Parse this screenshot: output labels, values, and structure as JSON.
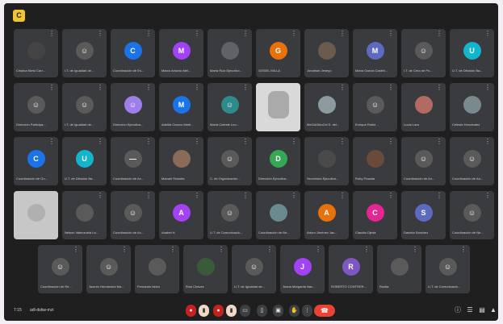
{
  "app": {
    "badge_initial": "C"
  },
  "bottom_bar": {
    "time": "7:15",
    "code": "adl-dsbw-mzi"
  },
  "rows": [
    [
      {
        "label": "Cristina Nieto Carr...",
        "initial": "",
        "color": "#444"
      },
      {
        "label": "I.T. de Igualdad de...",
        "initial": "☺",
        "color": "#5a5a5a"
      },
      {
        "label": "Coordinación de Es...",
        "initial": "C",
        "color": "#1a73e8"
      },
      {
        "label": "Marco Antonio Mel...",
        "initial": "M",
        "color": "#a142f4"
      },
      {
        "label": "Marta Ruiz Ejecutivo...",
        "initial": "",
        "color": "#5f6368"
      },
      {
        "label": "GISSEL MILLA",
        "initial": "G",
        "color": "#e8710a"
      },
      {
        "label": "Jonathan Jeneyo",
        "initial": "",
        "color": "#6b5a4e"
      },
      {
        "label": "María García Castell...",
        "initial": "M",
        "color": "#5c6bc0"
      },
      {
        "label": "I.T. de Cero de Po...",
        "initial": "☺",
        "color": "#5a5a5a"
      },
      {
        "label": "U.T. de Difusión Ba...",
        "initial": "U",
        "color": "#12b5cb"
      }
    ],
    [
      {
        "label": "Dirección Participa...",
        "initial": "☺",
        "color": "#5a5a5a"
      },
      {
        "label": "I.T. de Igualdad de...",
        "initial": "☺",
        "color": "#5a5a5a"
      },
      {
        "label": "Dirección Ejecutiva...",
        "initial": "☺",
        "color": "#9e7ee8"
      },
      {
        "label": "Adelita Orozco Marti...",
        "initial": "M",
        "color": "#1a73e8"
      },
      {
        "label": "María Celeste Leo...",
        "initial": "☺",
        "color": "#2f8a8a"
      },
      {
        "label": "",
        "initial": "",
        "color": "#aaa",
        "type": "video"
      },
      {
        "label": "MeGADibuCel S. del...",
        "initial": "",
        "color": "#8c9aa0"
      },
      {
        "label": "Enrique Roble...",
        "initial": "☺",
        "color": "#5a5a5a"
      },
      {
        "label": "Lucía Lara",
        "initial": "",
        "color": "#b46a64"
      },
      {
        "label": "Celeste Hernández",
        "initial": "",
        "color": "#7a8a8c"
      }
    ],
    [
      {
        "label": "Coordinación de Go...",
        "initial": "C",
        "color": "#1a73e8"
      },
      {
        "label": "U.T. de Difusión Ba...",
        "initial": "U",
        "color": "#12b5cb"
      },
      {
        "label": "Coordinación de Ac...",
        "initial": "—",
        "color": "#5a5a5a"
      },
      {
        "label": "Manuel Rosales",
        "initial": "",
        "color": "#8a6b5a"
      },
      {
        "label": "C. de Organización...",
        "initial": "☺",
        "color": "#5a5a5a"
      },
      {
        "label": "Dirección Ejecutiva...",
        "initial": "D",
        "color": "#34a853"
      },
      {
        "label": "Secretaría Ejecutiva...",
        "initial": "",
        "color": "#4a4a4a"
      },
      {
        "label": "Ruby Posada",
        "initial": "",
        "color": "#6a4a3a"
      },
      {
        "label": "Coordinación de An...",
        "initial": "☺",
        "color": "#5a5a5a"
      },
      {
        "label": "Coordinación de An...",
        "initial": "☺",
        "color": "#5a5a5a"
      }
    ],
    [
      {
        "label": "Alma Armendáriz",
        "initial": "",
        "color": "#b0b0b0",
        "type": "photo"
      },
      {
        "label": "Nelson Valenzuela La...",
        "initial": "",
        "color": "#5a5a5a"
      },
      {
        "label": "Coordinación de Ac...",
        "initial": "☺",
        "color": "#5a5a5a"
      },
      {
        "label": "Anabel H",
        "initial": "A",
        "color": "#a142f4"
      },
      {
        "label": "U.T. de Comunicació...",
        "initial": "☺",
        "color": "#5a5a5a"
      },
      {
        "label": "Coordinación de Be...",
        "initial": "",
        "color": "#6a8a90"
      },
      {
        "label": "Arturo Jiménez Jac...",
        "initial": "A",
        "color": "#e8710a"
      },
      {
        "label": "Claudia Ojeda",
        "initial": "C",
        "color": "#e52592"
      },
      {
        "label": "Daniela Sánchez",
        "initial": "S",
        "color": "#5c6bc0"
      },
      {
        "label": "Coordinación de Ne...",
        "initial": "☺",
        "color": "#5a5a5a"
      }
    ],
    [
      {
        "label": "Coordinación de Re...",
        "initial": "☺",
        "color": "#5a5a5a"
      },
      {
        "label": "Jazmín Hernández Ma...",
        "initial": "☺",
        "color": "#5a5a5a"
      },
      {
        "label": "Fernando Isidro",
        "initial": "",
        "color": "#5a5a5a"
      },
      {
        "label": "Rosi Chávez",
        "initial": "",
        "color": "#3a5a3a"
      },
      {
        "label": "U.T. de Igualdad de...",
        "initial": "☺",
        "color": "#5a5a5a"
      },
      {
        "label": "Juana Margarita Nav...",
        "initial": "J",
        "color": "#a142f4"
      },
      {
        "label": "ROBERTO CONTRER...",
        "initial": "R",
        "color": "#7e57c2"
      },
      {
        "label": "Rosita",
        "initial": "",
        "color": "#5a5a5a"
      },
      {
        "label": "U.T. de Comunicació...",
        "initial": "☺",
        "color": "#5a5a5a"
      }
    ]
  ],
  "controls": [
    "mic-on",
    "mic-off",
    "cam",
    "cc",
    "raise",
    "present",
    "emoji",
    "more"
  ],
  "right_icons": [
    "info-icon",
    "people-icon",
    "chat-icon",
    "activities-icon"
  ]
}
